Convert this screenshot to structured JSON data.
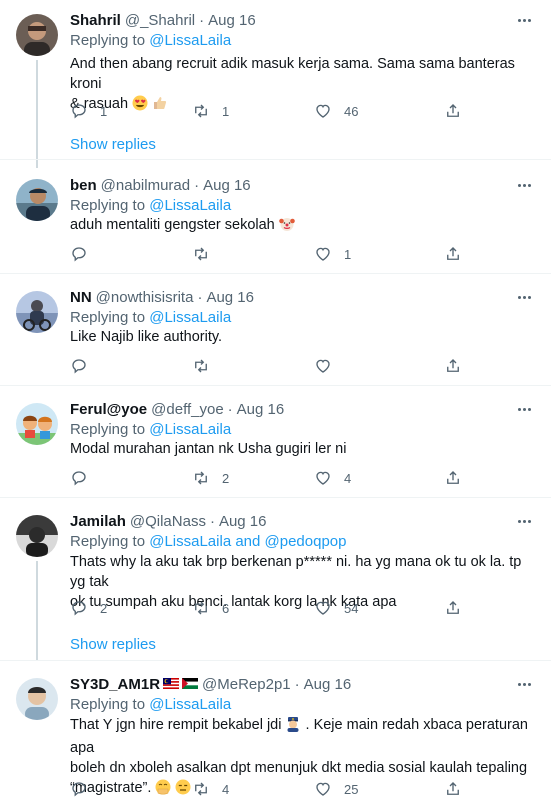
{
  "tweets": [
    {
      "name": "Shahril",
      "handle": "@_Shahril",
      "date": "Aug 16",
      "replying_label": "Replying to",
      "replying_to": "@LissaLaila",
      "text_line1": "And then abang recruit adik masuk kerja sama. Sama sama banteras kroni",
      "text_line2": "& rasuah",
      "emoji": [
        "heart-eyes",
        "thumbs-up"
      ],
      "replies": "1",
      "retweets": "1",
      "likes": "46",
      "show_replies": "Show replies"
    },
    {
      "name": "ben",
      "handle": "@nabilmurad",
      "date": "Aug 16",
      "replying_label": "Replying to",
      "replying_to": "@LissaLaila",
      "text_line1": "aduh mentaliti gengster sekolah",
      "emoji": [
        "clown-face"
      ],
      "replies": "",
      "retweets": "",
      "likes": "1"
    },
    {
      "name": "NN",
      "handle": "@nowthisisrita",
      "date": "Aug 16",
      "replying_label": "Replying to",
      "replying_to": "@LissaLaila",
      "text_line1": "Like Najib like authority.",
      "replies": "",
      "retweets": "",
      "likes": ""
    },
    {
      "name": "Ferul@yoe",
      "handle": "@deff_yoe",
      "date": "Aug 16",
      "replying_label": "Replying to",
      "replying_to": "@LissaLaila",
      "text_line1": "Modal murahan jantan nk Usha gugiri ler ni",
      "replies": "",
      "retweets": "2",
      "likes": "4"
    },
    {
      "name": "Jamilah",
      "handle": "@QilaNass",
      "date": "Aug 16",
      "replying_label": "Replying to",
      "replying_to": "@LissaLaila and @pedoqpop",
      "text_line1": "Thats why la aku tak brp berkenan p***** ni. ha yg mana ok tu ok la. tp yg tak",
      "text_line2": "ok tu sumpah aku benci. lantak korg la nk kata apa",
      "replies": "2",
      "retweets": "6",
      "likes": "54",
      "show_replies": "Show replies"
    },
    {
      "name": "SY3D_AM1R",
      "handle": "@MeRep2p1",
      "date": "Aug 16",
      "flags": [
        "malaysia-flag",
        "palestine-flag"
      ],
      "replying_label": "Replying to",
      "replying_to": "@LissaLaila",
      "text_line1a": "That Y jgn hire rempit bekabel jdi",
      "text_line1b": ". Keje main redah xbaca peraturan apa",
      "text_line2": "boleh dn xboleh asalkan dpt menunjuk dkt media sosial kaulah tepaling",
      "text_line3": "“magistrate”.",
      "emoji": [
        "police-officer",
        "face-with-hand-over-mouth",
        "expressionless-face"
      ],
      "replies": "",
      "retweets": "4",
      "likes": "25"
    }
  ],
  "colors": {
    "text": "#0f1419",
    "secondary": "#536471",
    "link": "#1d9bf0",
    "divider": "#eff3f4"
  }
}
